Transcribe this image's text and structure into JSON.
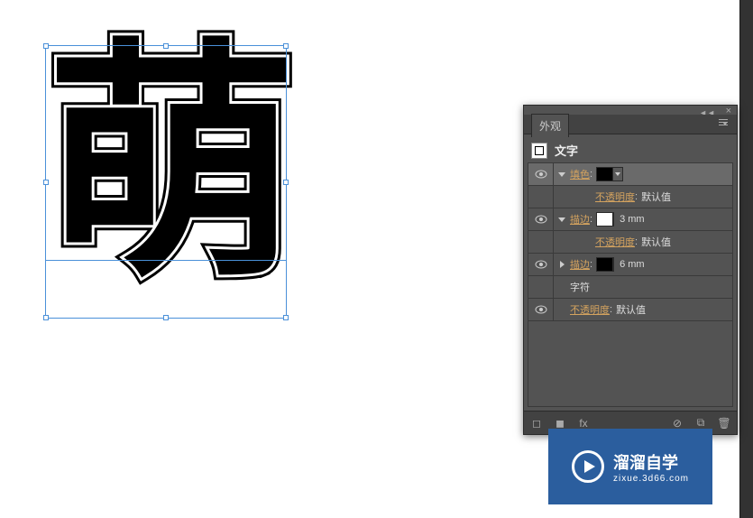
{
  "canvas": {
    "character": "萌"
  },
  "panel": {
    "title_tab": "外观",
    "object_type": "文字",
    "rows": {
      "fill": {
        "label": "填色",
        "colon": ":"
      },
      "opacity1": {
        "label": "不透明度",
        "colon": ":",
        "value": "默认值"
      },
      "stroke1": {
        "label": "描边",
        "colon": ":",
        "value": "3 mm"
      },
      "opacity2": {
        "label": "不透明度",
        "colon": ":",
        "value": "默认值"
      },
      "stroke2": {
        "label": "描边",
        "colon": ":",
        "value": "6 mm"
      },
      "characters": {
        "label": "字符"
      },
      "opacity3": {
        "label": "不透明度",
        "colon": ":",
        "value": "默认值"
      }
    },
    "footer_fx": "fx"
  },
  "watermark": {
    "main": "溜溜自学",
    "sub": "zixue.3d66.com"
  }
}
